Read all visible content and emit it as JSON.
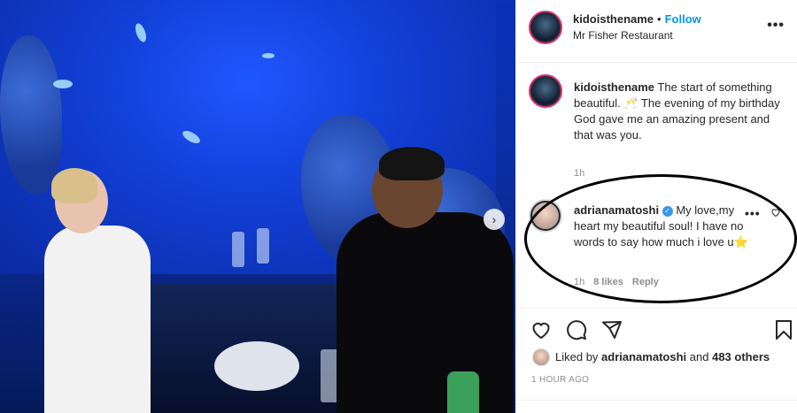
{
  "post": {
    "username": "kidoisthename",
    "follow_label": "Follow",
    "separator": "•",
    "location": "Mr Fisher Restaurant",
    "more_label": "•••"
  },
  "caption": {
    "username": "kidoisthename",
    "text": "The start of something beautiful. 🥂 The evening of my birthday God gave me an amazing present and that was you.",
    "time": "1h"
  },
  "comment": {
    "username": "adrianamatoshi",
    "verified_mark": "✓",
    "text": "My love,my heart my beautiful soul! I have no words to say how much i love u⭐",
    "time": "1h",
    "likes": "8 likes",
    "reply_label": "Reply",
    "more_label": "•••"
  },
  "likes": {
    "prefix": "Liked by",
    "user": "adrianamatoshi",
    "joiner": "and",
    "others": "483 others"
  },
  "posted_time": "1 HOUR AGO",
  "photo": {
    "next_label": "›"
  },
  "colors": {
    "accent": "#0095f6",
    "annotation_ring": "#000000"
  }
}
